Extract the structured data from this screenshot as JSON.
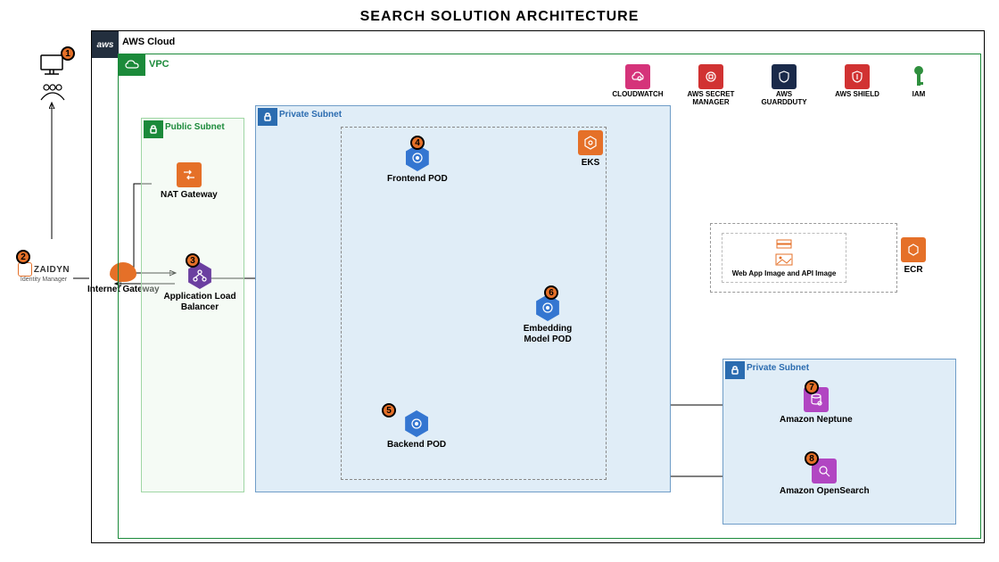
{
  "title": "SEARCH SOLUTION ARCHITECTURE",
  "containers": {
    "aws_cloud": "AWS Cloud",
    "vpc": "VPC",
    "public_subnet": "Public Subnet",
    "private_subnet_1": "Private Subnet",
    "private_subnet_2": "Private Subnet"
  },
  "badges": {
    "b1": "1",
    "b2": "2",
    "b3": "3",
    "b4": "4",
    "b5": "5",
    "b6": "6",
    "b7": "7",
    "b8": "8"
  },
  "nodes": {
    "zaidyn": "ZAIDYN",
    "zaidyn_sub": "Identity Manager",
    "internet_gateway": "Internet Gateway",
    "nat_gateway": "NAT Gateway",
    "alb": "Application Load Balancer",
    "frontend_pod": "Frontend POD",
    "backend_pod": "Backend POD",
    "embedding_pod": "Embedding Model POD",
    "eks": "EKS",
    "neptune": "Amazon Neptune",
    "opensearch": "Amazon OpenSearch",
    "ecr": "ECR",
    "ecr_inner": "Web App Image and API Image"
  },
  "services": {
    "cloudwatch": "CLOUDWATCH",
    "secret_manager": "AWS SECRET MANAGER",
    "guardduty": "AWS GUARDDUTY",
    "shield": "AWS SHIELD",
    "iam": "IAM"
  },
  "colors": {
    "orange": "#e57028",
    "blue_hex": "#3476d1",
    "purple": "#b146c2",
    "magenta": "#d5337a",
    "red": "#d13232",
    "navy": "#1a2a4a",
    "green": "#2f8f3e"
  }
}
